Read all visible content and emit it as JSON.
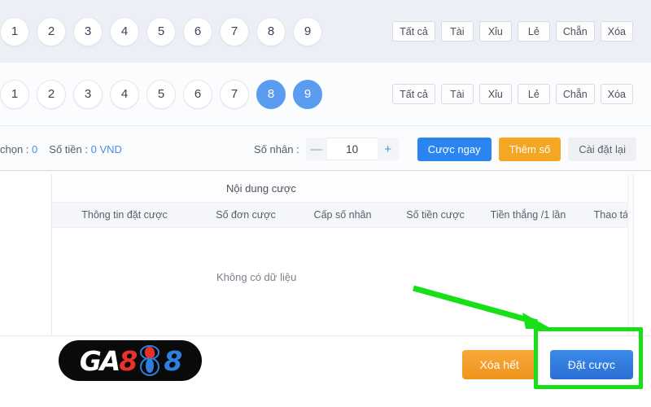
{
  "rows": [
    {
      "name": "row-top",
      "numbers": [
        {
          "label": "1",
          "selected": false
        },
        {
          "label": "2",
          "selected": false
        },
        {
          "label": "3",
          "selected": false
        },
        {
          "label": "4",
          "selected": false
        },
        {
          "label": "5",
          "selected": false
        },
        {
          "label": "6",
          "selected": false
        },
        {
          "label": "7",
          "selected": false
        },
        {
          "label": "8",
          "selected": false
        },
        {
          "label": "9",
          "selected": false
        }
      ],
      "quick_buttons": [
        "Tất cả",
        "Tài",
        "Xỉu",
        "Lẻ",
        "Chẵn",
        "Xóa"
      ]
    },
    {
      "name": "row-second",
      "numbers": [
        {
          "label": "1",
          "selected": false
        },
        {
          "label": "2",
          "selected": false
        },
        {
          "label": "3",
          "selected": false
        },
        {
          "label": "4",
          "selected": false
        },
        {
          "label": "5",
          "selected": false
        },
        {
          "label": "6",
          "selected": false
        },
        {
          "label": "7",
          "selected": false
        },
        {
          "label": "8",
          "selected": true
        },
        {
          "label": "9",
          "selected": true
        }
      ],
      "quick_buttons": [
        "Tất cả",
        "Tài",
        "Xỉu",
        "Lẻ",
        "Chẵn",
        "Xóa"
      ]
    }
  ],
  "toolbar": {
    "selected_label": "chọn :",
    "selected_count": "0",
    "amount_label": "Số tiền :",
    "amount_value": "0 VND",
    "multiplier_label": "Số nhân :",
    "multiplier_value": "10",
    "minus_glyph": "—",
    "plus_glyph": "+",
    "bet_now_label": "Cược ngay",
    "add_number_label": "Thêm số",
    "reset_label": "Cài đặt lại"
  },
  "table": {
    "title": "Nội dung cược",
    "columns": [
      "Thông tin đặt cược",
      "Số đơn cược",
      "Cấp số nhân",
      "Số tiền cược",
      "Tiền thắng /1 lần",
      "Thao tác"
    ],
    "empty_text": "Không có dữ liệu",
    "rows": []
  },
  "footer": {
    "clear_all_label": "Xóa hết",
    "place_bet_label": "Đặt cược"
  },
  "logo": {
    "part_ga": "GA",
    "part_eight_red": "8",
    "part_eight_blue": "8"
  },
  "colors": {
    "selected_ball": "#5a9df0",
    "primary_button": "#2a85f0",
    "warning_button": "#f5a623",
    "accent_text": "#4a90e2",
    "annotation_green": "#18e018",
    "row_a_background": "#edeff7"
  }
}
